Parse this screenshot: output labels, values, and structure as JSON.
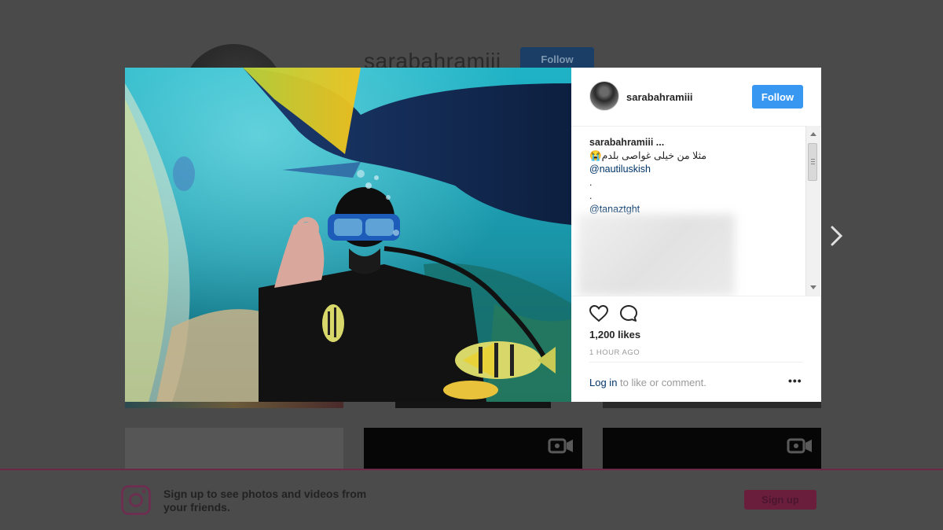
{
  "background_profile": {
    "username": "sarabahramiii",
    "follow_label": "Follow"
  },
  "signup_banner": {
    "text": "Sign up to see photos and videos from your friends.",
    "signup_label": "Sign up"
  },
  "post": {
    "username": "sarabahramiii",
    "follow_label": "Follow",
    "caption": {
      "username": "sarabahramiii",
      "more": "...",
      "arabic_line": "😭مثلا من خیلی غواصی بلدم",
      "mentions": [
        "@nautiluskish",
        "@tanaztght"
      ],
      "dots": [
        ".",
        "."
      ]
    },
    "likes": "1,200 likes",
    "timestamp": "1 HOUR AGO",
    "login_link": "Log in",
    "login_suffix": " to like or comment.",
    "more_options": "•••"
  },
  "icons": {
    "like": "heart-icon",
    "comment": "comment-icon",
    "next": "chevron-right-icon",
    "video": "video-camera-icon",
    "logo": "instagram-logo-icon",
    "options": "more-options-icon"
  },
  "colors": {
    "accent": "#3897f0",
    "link": "#003569",
    "overlay": "#4a4a4a"
  }
}
